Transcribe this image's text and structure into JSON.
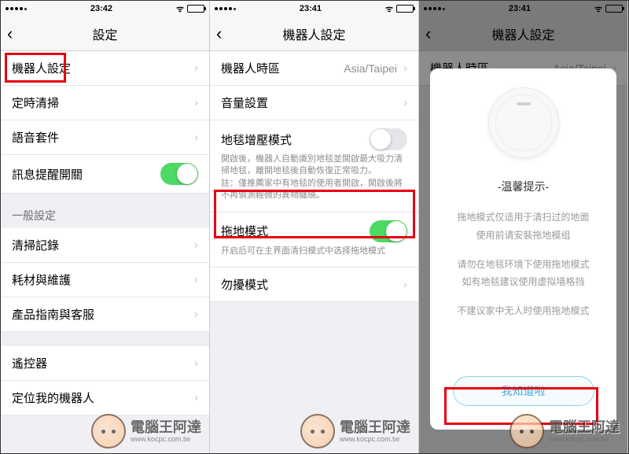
{
  "screen1": {
    "time": "23:42",
    "title": "設定",
    "rows": {
      "robot_settings": "機器人設定",
      "scheduled_clean": "定時清掃",
      "voice_pack": "語音套件",
      "msg_alert": "訊息提醒開關",
      "general_header": "一般設定",
      "clean_history": "清掃記錄",
      "consumables": "耗材與維護",
      "guide_support": "產品指南與客服",
      "remote": "遙控器",
      "locate": "定位我的機器人"
    }
  },
  "screen2": {
    "time": "23:41",
    "title": "機器人設定",
    "rows": {
      "timezone_label": "機器人時區",
      "timezone_value": "Asia/Taipei",
      "volume": "音量設置",
      "carpet_boost": "地毯增壓模式",
      "carpet_desc": "開啟後，機器人自動識別地毯並開啟最大吸力清掃地毯，離開地毯後自動恢復正常吸力。\n註：僅推薦家中有地毯的使用者開啟，開啟後將不再偵測輕微的異物纏繞。",
      "mop_mode": "拖地模式",
      "mop_desc": "开启后可在主界面清扫模式中选择拖地模式",
      "dnd": "勿擾模式"
    }
  },
  "screen3": {
    "time": "23:41",
    "title": "機器人設定",
    "bg_timezone_label": "機器人時區",
    "bg_timezone_value": "Asia/Taipei",
    "modal": {
      "title": "-温馨提示-",
      "line1": "拖地模式仅适用于清扫过的地面",
      "line2": "使用前请安裝拖地模组",
      "line3": "请勿在地毯环境下使用拖地模式",
      "line4": "如有地毯建议使用虚拟墙格挡",
      "line5": "不建议家中无人时使用拖地模式",
      "button": "我知道啦"
    }
  },
  "watermark": {
    "name": "電腦王阿達",
    "url": "www.kocpc.com.tw"
  }
}
